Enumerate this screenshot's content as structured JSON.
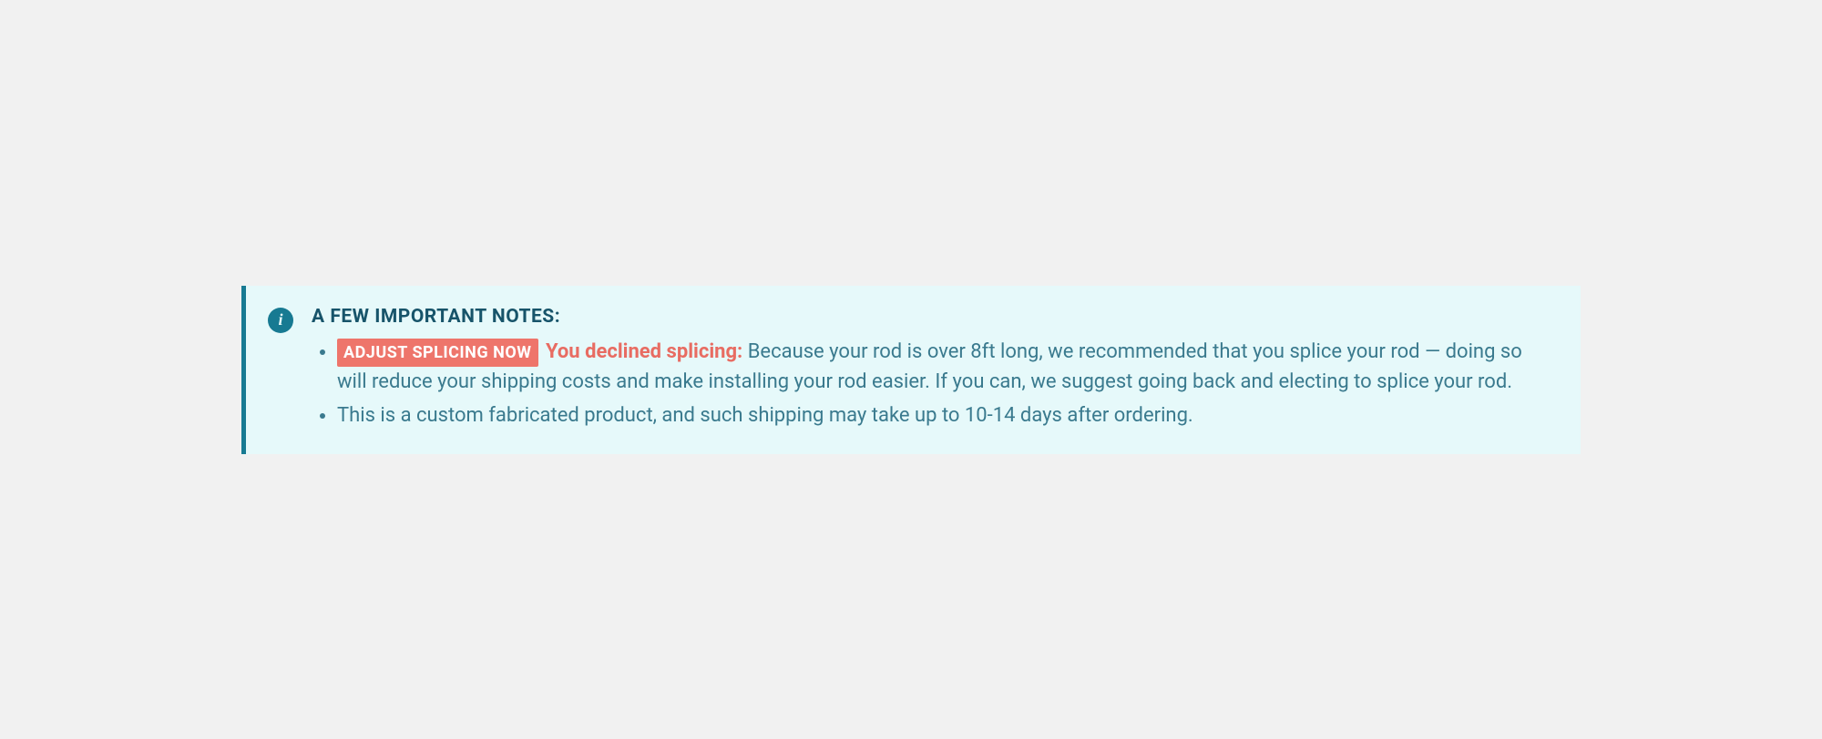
{
  "alert": {
    "heading": "A FEW IMPORTANT NOTES:",
    "info_icon_glyph": "i",
    "notes": [
      {
        "badge": "ADJUST SPLICING NOW",
        "warning_label": "You declined splicing:",
        "body": "Because your rod is over 8ft long, we recommended that you splice your rod — doing so will reduce your shipping costs and make installing your rod easier. If you can, we suggest going back and electing to splice your rod."
      },
      {
        "body": "This is a custom fabricated product, and such shipping may take up to 10-14 days after ordering."
      }
    ]
  }
}
